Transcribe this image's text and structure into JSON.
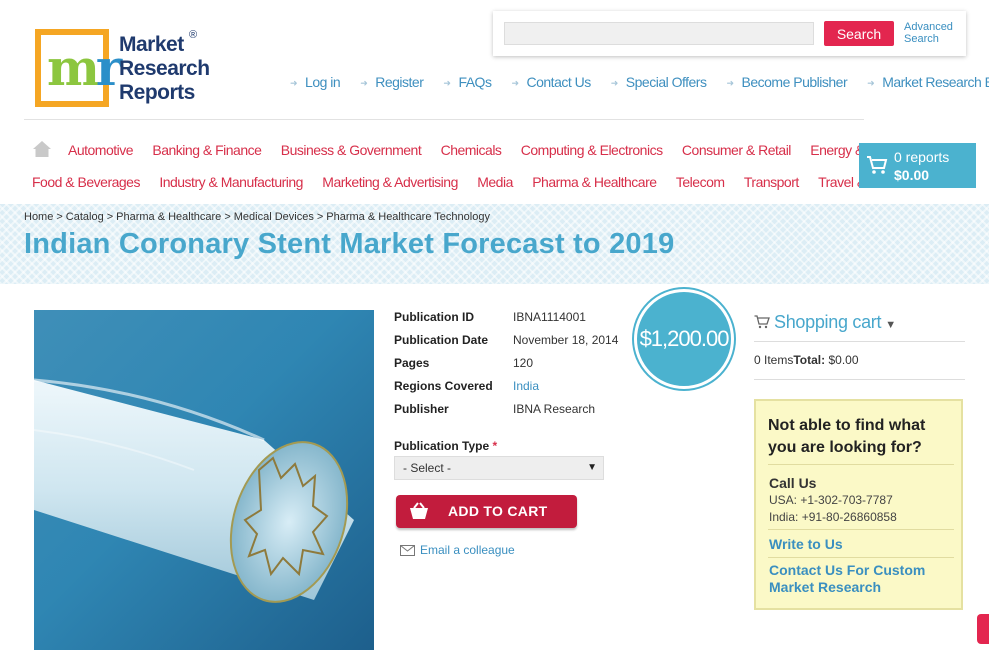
{
  "logo": {
    "line1": "Market",
    "line2": "Research",
    "line3": "Reports",
    "reg": "®"
  },
  "search": {
    "placeholder": "",
    "button": "Search",
    "advanced_line1": "Advanced",
    "advanced_line2": "Search"
  },
  "top_links": [
    "Log in",
    "Register",
    "FAQs",
    "Contact Us",
    "Special Offers",
    "Become Publisher",
    "Market Research Blog"
  ],
  "nav": {
    "row1": [
      "Automotive",
      "Banking & Finance",
      "Business & Government",
      "Chemicals",
      "Computing & Electronics",
      "Consumer & Retail",
      "Energy & Utilities"
    ],
    "row2": [
      "Food & Beverages",
      "Industry & Manufacturing",
      "Marketing & Advertising",
      "Media",
      "Pharma & Healthcare",
      "Telecom",
      "Transport",
      "Travel & Leisure"
    ]
  },
  "cart": {
    "count": "0 reports",
    "total": "$0.00"
  },
  "breadcrumb": [
    "Home",
    "Catalog",
    "Pharma & Healthcare",
    "Medical Devices",
    "Pharma & Healthcare Technology"
  ],
  "breadcrumb_sep": ">",
  "title": "Indian Coronary Stent Market Forecast to 2019",
  "info": {
    "publication_id_label": "Publication ID",
    "publication_id": "IBNA1114001",
    "publication_date_label": "Publication Date",
    "publication_date": "November 18, 2014",
    "pages_label": "Pages",
    "pages": "120",
    "regions_label": "Regions Covered",
    "regions": "India",
    "publisher_label": "Publisher",
    "publisher": "IBNA Research"
  },
  "price": "$1,200.00",
  "publication_type": {
    "label": "Publication Type",
    "required": "*",
    "selected": "- Select -"
  },
  "add_to_cart": "ADD TO CART",
  "email_colleague": "Email a colleague",
  "sidebar": {
    "cart_title": "Shopping cart",
    "items_label": "0 Items",
    "total_label": "Total:",
    "total_value": "$0.00",
    "help_question": "Not able to find what you are looking for?",
    "call_us": "Call Us",
    "phone_usa": "USA: +1-302-703-7787",
    "phone_india": "India: +91-80-26860858",
    "write_to_us": "Write to Us",
    "custom_research": "Contact Us For Custom Market Research"
  },
  "colors": {
    "accent_red": "#d72f4a",
    "accent_blue": "#48a7cc",
    "logo_orange": "#f5a623"
  }
}
